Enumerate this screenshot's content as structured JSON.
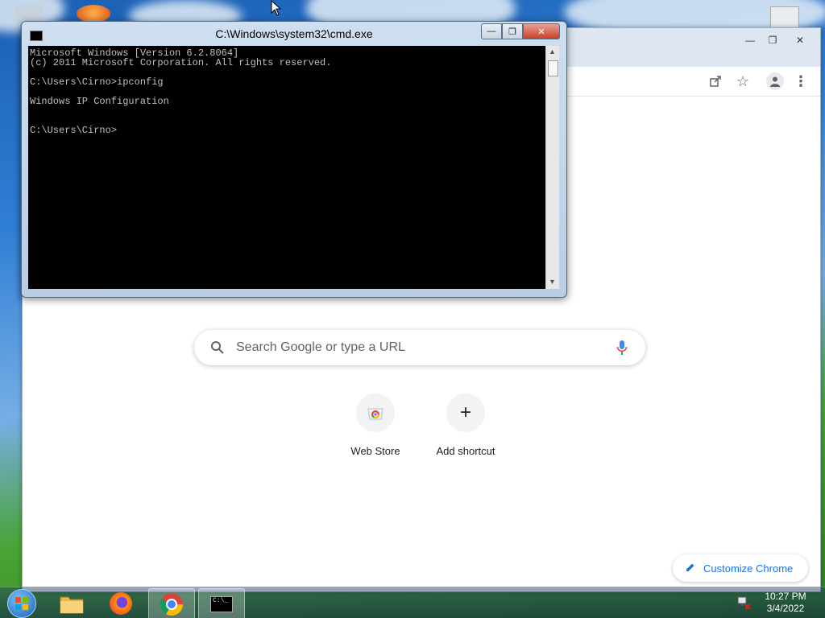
{
  "colors": {
    "cmd_background": "#000000",
    "cmd_text": "#c0c0c0",
    "chrome_accent": "#1a73e8"
  },
  "cmd": {
    "title": "C:\\Windows\\system32\\cmd.exe",
    "icon": "cmd-icon",
    "lines": [
      "Microsoft Windows [Version 6.2.8064]",
      "(c) 2011 Microsoft Corporation. All rights reserved.",
      "C:\\Users\\Cirno>ipconfig",
      "Windows IP Configuration",
      "C:\\Users\\Cirno>"
    ]
  },
  "chrome": {
    "search": {
      "placeholder": "Search Google or type a URL",
      "search_icon": "search-icon",
      "mic_icon": "mic-icon"
    },
    "toolbar_icons": [
      "share-icon",
      "star-icon",
      "profile-icon",
      "menu-icon"
    ],
    "shortcuts": [
      {
        "label": "Web Store",
        "icon": "web-store-icon"
      },
      {
        "label": "Add shortcut",
        "icon": "plus-icon"
      }
    ],
    "customize_label": "Customize Chrome"
  },
  "taskbar": {
    "items": [
      "start-orb-icon",
      "file-explorer-icon",
      "firefox-icon",
      "chrome-icon",
      "cmd-icon"
    ],
    "time": "10:27 PM",
    "date": "3/4/2022"
  }
}
